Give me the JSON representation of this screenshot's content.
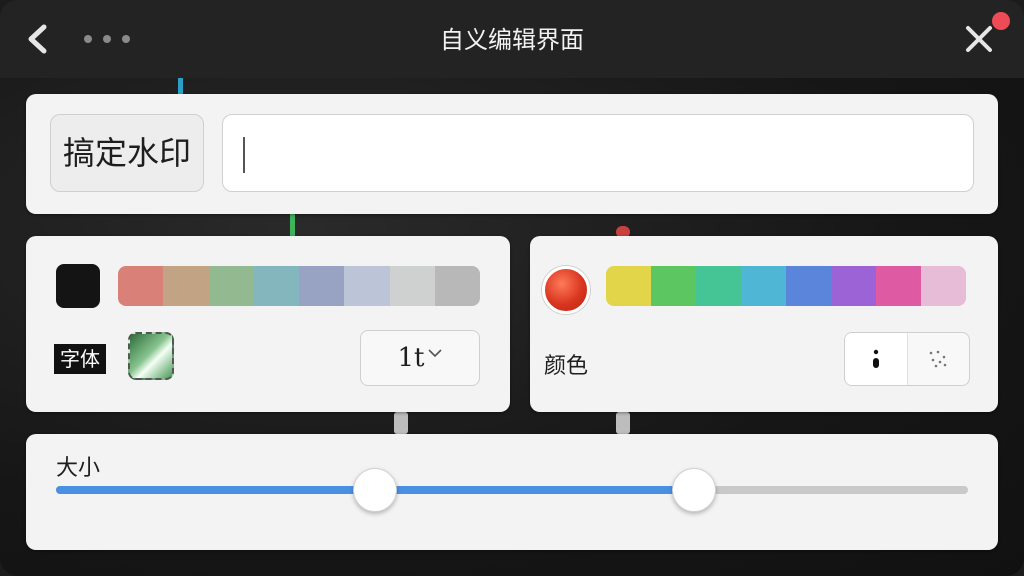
{
  "header": {
    "title": "自义编辑界面",
    "back_icon": "chevron-left-icon",
    "more_icon": "more-dots-icon",
    "close_icon": "close-icon",
    "notification_color": "#ef4b56"
  },
  "watermark": {
    "button_label": "搞定水印",
    "input_value": "",
    "input_placeholder": ""
  },
  "font_panel": {
    "font_label": "字体",
    "selected_swatch_color": "#141414",
    "palette": [
      "#d98078",
      "#c2a384",
      "#93b990",
      "#83b6bd",
      "#98a3c4",
      "#bcc4d8",
      "#cfd0d0",
      "#b8b8b8"
    ],
    "size_value": "1t",
    "size_chevron": "chevron-down-icon"
  },
  "color_panel": {
    "label": "颜色",
    "selected_color": "#d9361f",
    "palette": [
      "#e3d54a",
      "#5cc760",
      "#45c596",
      "#50b6d6",
      "#5a85db",
      "#9b63d6",
      "#de5aa3",
      "#e6bcd6"
    ],
    "style_options": [
      "dot-style-icon",
      "scatter-style-icon"
    ]
  },
  "size_panel": {
    "label": "大小",
    "range_low": 0.35,
    "range_high": 0.7,
    "fill_color": "#4a90e2"
  }
}
